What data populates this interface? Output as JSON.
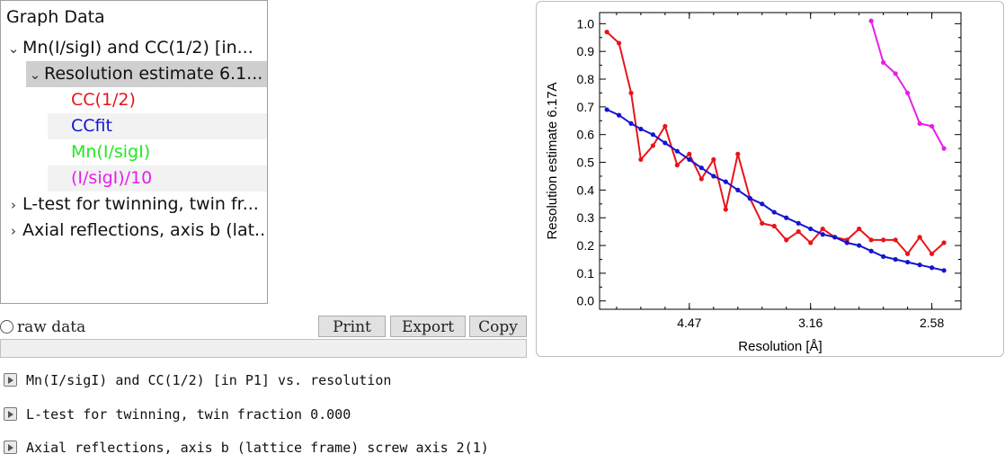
{
  "tree": {
    "header": "Graph Data",
    "items": [
      {
        "label": "Mn(I/sigI) and CC(1/2) [in..."
      },
      {
        "label": "Resolution estimate 6.1..."
      },
      {
        "label": "CC(1/2)",
        "color": "#e8141a"
      },
      {
        "label": "CCfit",
        "color": "#1414d2"
      },
      {
        "label": "Mn(I/sigI)",
        "color": "#22e81e"
      },
      {
        "label": "(I/sigI)/10",
        "color": "#e81ee8"
      },
      {
        "label": "L-test for twinning, twin fr..."
      },
      {
        "label": "Axial reflections, axis b (lat..."
      }
    ]
  },
  "controls": {
    "raw_data_label": "raw data",
    "print_label": "Print",
    "export_label": "Export",
    "copy_label": "Copy"
  },
  "log": [
    "Mn(I/sigI) and CC(1/2) [in P1] vs. resolution",
    "L-test for twinning, twin fraction 0.000",
    "Axial reflections, axis b (lattice frame) screw axis 2(1)"
  ],
  "chart_data": {
    "type": "line",
    "title": "",
    "xlabel": "Resolution [Å]",
    "ylabel": "Resolution estimate 6.17A",
    "xlim": [
      0.013,
      0.162
    ],
    "ylim": [
      -0.03,
      1.04
    ],
    "x_ticks": [
      {
        "value": 0.05,
        "label": "4.47"
      },
      {
        "value": 0.1,
        "label": "3.16"
      },
      {
        "value": 0.15,
        "label": "2.58"
      }
    ],
    "y_ticks": [
      0.0,
      0.1,
      0.2,
      0.3,
      0.4,
      0.5,
      0.6,
      0.7,
      0.8,
      0.9,
      1.0
    ],
    "series": [
      {
        "color": "#e8141a",
        "x": [
          0.016,
          0.021,
          0.026,
          0.03,
          0.035,
          0.04,
          0.045,
          0.05,
          0.055,
          0.06,
          0.065,
          0.07,
          0.075,
          0.08,
          0.085,
          0.09,
          0.095,
          0.1,
          0.105,
          0.11,
          0.115,
          0.12,
          0.125,
          0.13,
          0.135,
          0.14,
          0.145,
          0.15,
          0.155
        ],
        "y": [
          0.97,
          0.93,
          0.75,
          0.51,
          0.56,
          0.63,
          0.49,
          0.53,
          0.44,
          0.51,
          0.33,
          0.53,
          0.37,
          0.28,
          0.27,
          0.22,
          0.25,
          0.21,
          0.26,
          0.23,
          0.22,
          0.26,
          0.22,
          0.22,
          0.22,
          0.17,
          0.23,
          0.17,
          0.21
        ]
      },
      {
        "color": "#1414d2",
        "x": [
          0.016,
          0.021,
          0.026,
          0.03,
          0.035,
          0.04,
          0.045,
          0.05,
          0.055,
          0.06,
          0.065,
          0.07,
          0.075,
          0.08,
          0.085,
          0.09,
          0.095,
          0.1,
          0.105,
          0.11,
          0.115,
          0.12,
          0.125,
          0.13,
          0.135,
          0.14,
          0.145,
          0.15,
          0.155
        ],
        "y": [
          0.69,
          0.67,
          0.64,
          0.62,
          0.6,
          0.57,
          0.54,
          0.51,
          0.48,
          0.45,
          0.43,
          0.4,
          0.37,
          0.35,
          0.32,
          0.3,
          0.28,
          0.26,
          0.24,
          0.23,
          0.21,
          0.2,
          0.18,
          0.16,
          0.15,
          0.14,
          0.13,
          0.12,
          0.11
        ]
      },
      {
        "color": "#e81ee8",
        "x": [
          0.125,
          0.13,
          0.135,
          0.14,
          0.145,
          0.15,
          0.155
        ],
        "y": [
          1.01,
          0.86,
          0.82,
          0.75,
          0.64,
          0.63,
          0.55
        ]
      }
    ]
  }
}
